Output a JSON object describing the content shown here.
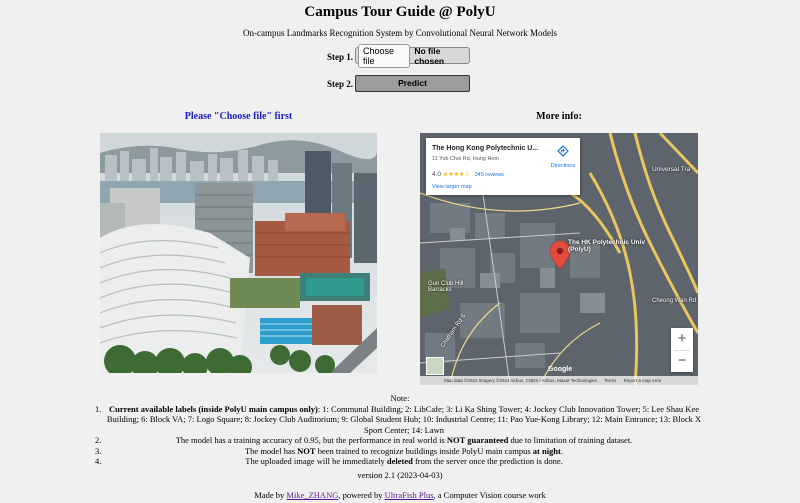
{
  "header": {
    "title": "Campus Tour Guide @ PolyU",
    "subtitle": "On-campus Landmarks Recognition System by Convolutional Neural Network Models"
  },
  "step1": {
    "label": "Step 1.",
    "choose_button": "Choose file",
    "file_status": "No file chosen"
  },
  "step2": {
    "label": "Step 2.",
    "predict_button": "Predict"
  },
  "left_panel": {
    "message": "Please \"Choose file\" first"
  },
  "right_panel": {
    "heading": "More info:",
    "map": {
      "place_name": "The Hong Kong Polytechnic U...",
      "address": "11 Yuk Choi Rd, Hung Hom",
      "directions_label": "Directions",
      "rating": "4.0",
      "stars": "★★★★☆",
      "reviews": "345 reviews",
      "view_larger": "View larger map",
      "zoom_in": "+",
      "zoom_out": "−",
      "google": "Google",
      "attribution": "Map data ©2024 Imagery ©2024 Airbus, CNES / Airbus, Maxar Technologies",
      "terms": "Terms",
      "report": "Report a map error",
      "labels": {
        "univ": "The HK Polytechnic Univ (PolyU)",
        "barracks": "Gun Club Hill Barracks",
        "chatham": "Chatham Rd S",
        "cheong": "Cheong Wan Rd",
        "universal": "Universal Tra"
      }
    }
  },
  "notes": {
    "heading": "Note:",
    "items": [
      {
        "num": "1.",
        "bold": "Current available labels (inside PolyU main campus only)",
        "text": ": 1: Communal Building; 2: LibCafe; 3: Li Ka Shing Tower; 4: Jockey Club Innovation Tower; 5: Lee Shau Kee Building; 6: Block VA; 7: Logo Square; 8: Jockey Club Auditorium; 9: Global Student Hub; 10: Industrial Centre; 11: Pao Yue-Kong Library; 12: Main Entrance; 13: Block X Sport Center; 14: Lawn"
      },
      {
        "num": "2.",
        "pre": "The model has a training accuracy of 0.95, but the performance in real world is ",
        "bold": "NOT guaranteed",
        "post": " due to limitation of training dataset."
      },
      {
        "num": "3.",
        "pre": "The model has ",
        "bold": "NOT",
        "mid": " been trained to recognize buildings inside PolyU main campus ",
        "bold2": "at night",
        "post": "."
      },
      {
        "num": "4.",
        "pre": "The uploaded image will be immediately ",
        "bold": "deleted",
        "post": " from the server once the prediction is done."
      }
    ]
  },
  "footer": {
    "version": "version 2.1 (2023-04-03)",
    "made_by_pre": "Made by ",
    "author": "Mike_ZHANG",
    "made_by_mid": ", powered by ",
    "powered": "UltraFish Plus",
    "made_by_post": ", a Computer Vision course work"
  }
}
